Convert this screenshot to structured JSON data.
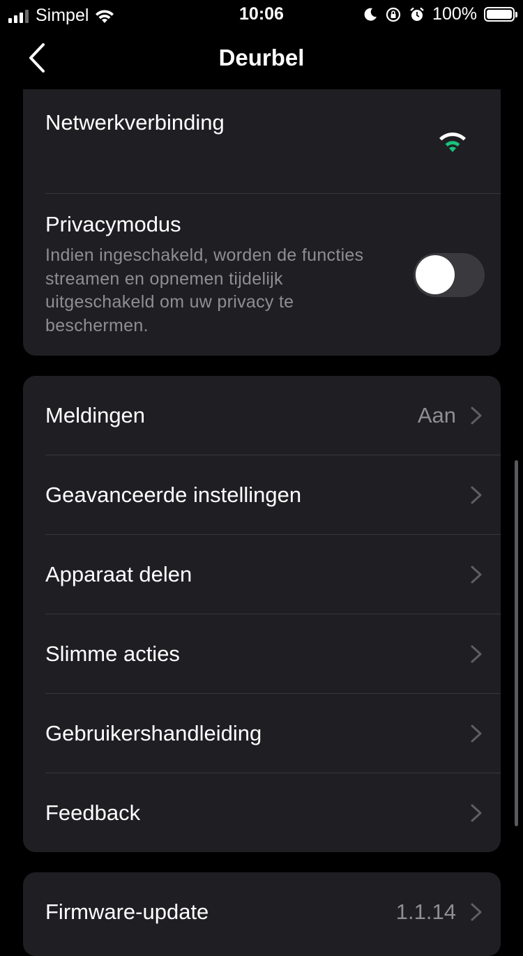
{
  "status_bar": {
    "carrier": "Simpel",
    "time": "10:06",
    "battery": "100%"
  },
  "nav": {
    "title": "Deurbel"
  },
  "device_section": {
    "network_label": "Netwerkverbinding",
    "privacy_title": "Privacymodus",
    "privacy_description": "Indien ingeschakeld, worden de functies streamen en opnemen tijdelijk uitgeschakeld om uw privacy te beschermen.",
    "privacy_enabled": false
  },
  "settings": [
    {
      "label": "Meldingen",
      "value": "Aan"
    },
    {
      "label": "Geavanceerde instellingen",
      "value": ""
    },
    {
      "label": "Apparaat delen",
      "value": ""
    },
    {
      "label": "Slimme acties",
      "value": ""
    },
    {
      "label": "Gebruikershandleiding",
      "value": ""
    },
    {
      "label": "Feedback",
      "value": ""
    }
  ],
  "firmware": {
    "label": "Firmware-update",
    "value": "1.1.14"
  },
  "colors": {
    "background": "#000000",
    "card": "#1f1f23",
    "secondary_text": "#8e8e93",
    "wifi_accent": "#19c37d"
  }
}
